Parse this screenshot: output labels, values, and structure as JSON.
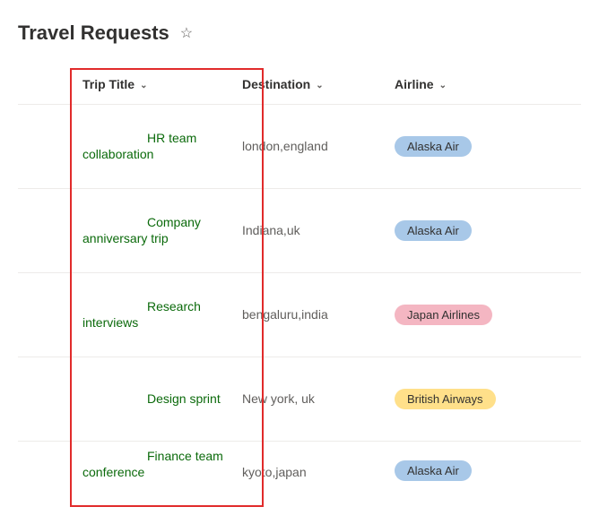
{
  "header": {
    "title": "Travel Requests"
  },
  "columns": {
    "trip_title": "Trip Title",
    "destination": "Destination",
    "airline": "Airline"
  },
  "airline_colors": {
    "Alaska Air": "#a8c8e8",
    "Japan Airlines": "#f4b6c2",
    "British Airways": "#ffe08a"
  },
  "rows": [
    {
      "title": "HR team collaboration",
      "destination": "london,england",
      "airline": "Alaska Air"
    },
    {
      "title": "Company anniversary trip",
      "destination": "Indiana,uk",
      "airline": "Alaska Air"
    },
    {
      "title": "Research interviews",
      "destination": "bengaluru,india",
      "airline": "Japan Airlines"
    },
    {
      "title": "Design sprint",
      "destination": "New york, uk",
      "airline": "British Airways"
    },
    {
      "title": "Finance team conference",
      "destination": "kyoto,japan",
      "airline": "Alaska Air"
    }
  ]
}
